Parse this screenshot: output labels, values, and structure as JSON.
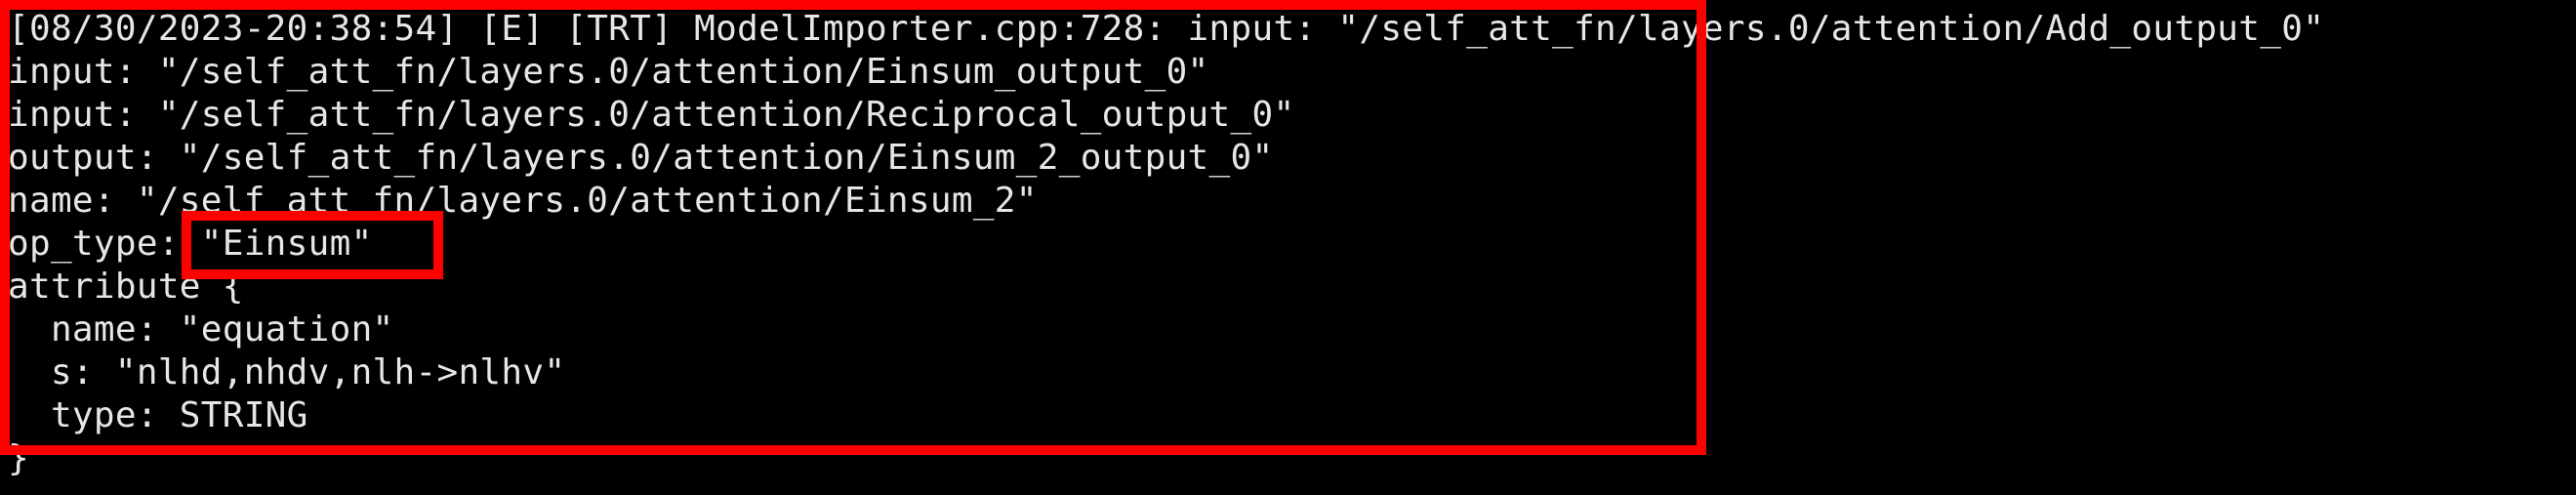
{
  "terminal": {
    "background": "#000000",
    "text_color": "#e6e6e6",
    "highlight_color": "#ff0000",
    "lines": [
      "[08/30/2023-20:38:54] [E] [TRT] ModelImporter.cpp:728: input: \"/self_att_fn/layers.0/attention/Add_output_0\"",
      "input: \"/self_att_fn/layers.0/attention/Einsum_output_0\"",
      "input: \"/self_att_fn/layers.0/attention/Reciprocal_output_0\"",
      "output: \"/self_att_fn/layers.0/attention/Einsum_2_output_0\"",
      "name: \"/self_att_fn/layers.0/attention/Einsum_2\"",
      "op_type: \"Einsum\"",
      "attribute {",
      "  name: \"equation\"",
      "  s: \"nlhd,nhdv,nlh->nlhv\"",
      "  type: STRING",
      "}"
    ]
  }
}
